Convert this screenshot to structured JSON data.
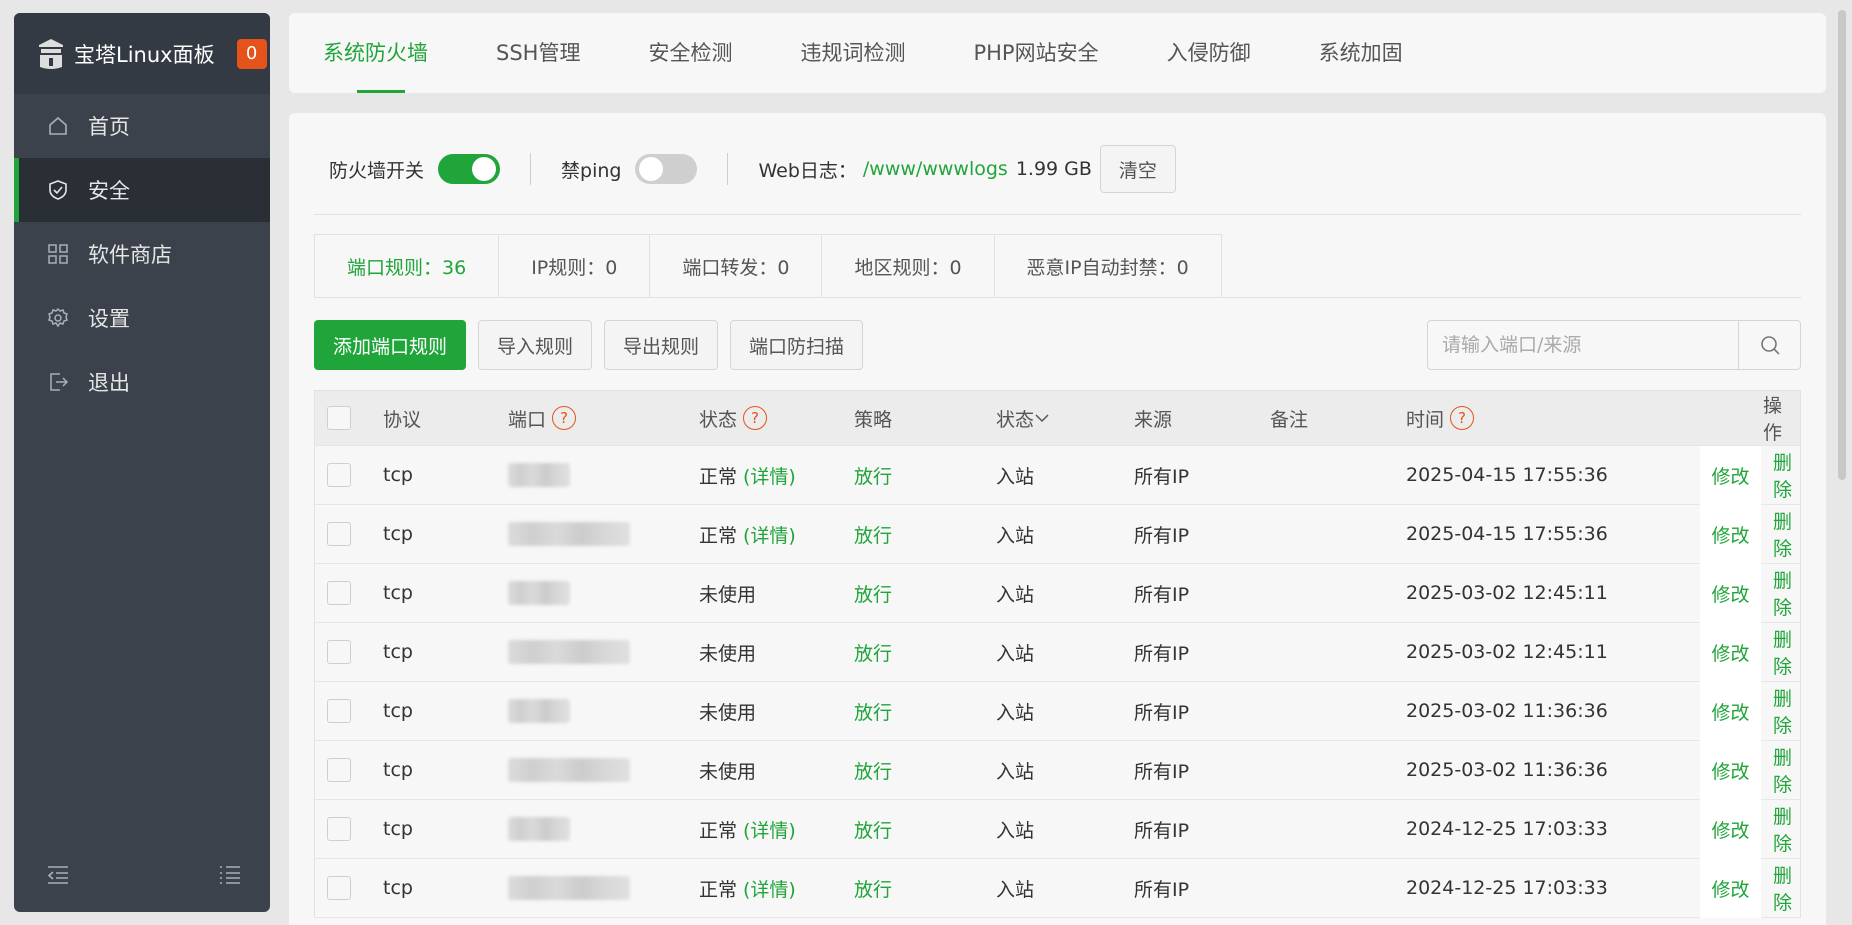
{
  "sidebar": {
    "brand": "宝塔Linux面板",
    "badge": "0",
    "items": [
      {
        "label": "首页",
        "icon": "home-icon"
      },
      {
        "label": "安全",
        "icon": "shield-icon"
      },
      {
        "label": "软件商店",
        "icon": "grid-icon"
      },
      {
        "label": "设置",
        "icon": "gear-icon"
      },
      {
        "label": "退出",
        "icon": "logout-icon"
      }
    ],
    "active_index": 1
  },
  "top_tabs": [
    "系统防火墙",
    "SSH管理",
    "安全检测",
    "违规词检测",
    "PHP网站安全",
    "入侵防御",
    "系统加固"
  ],
  "toolbar": {
    "firewall_label": "防火墙开关",
    "firewall_on": true,
    "ping_label": "禁ping",
    "ping_on": false,
    "weblog_label": "Web日志：",
    "weblog_path": "/www/wwwlogs",
    "weblog_size": "1.99 GB",
    "clear_label": "清空"
  },
  "sub_tabs": [
    "端口规则：36",
    "IP规则：0",
    "端口转发：0",
    "地区规则：0",
    "恶意IP自动封禁：0"
  ],
  "actions": {
    "add": "添加端口规则",
    "import": "导入规则",
    "export": "导出规则",
    "scan": "端口防扫描"
  },
  "search": {
    "placeholder": "请输入端口/来源"
  },
  "table": {
    "headers": {
      "protocol": "协议",
      "port": "端口",
      "status": "状态",
      "policy": "策略",
      "direction": "状态",
      "source": "来源",
      "note": "备注",
      "time": "时间",
      "ops": "操作"
    },
    "rows": [
      {
        "protocol": "tcp",
        "status": "正常",
        "detail": "(详情)",
        "policy": "放行",
        "direction": "入站",
        "source": "所有IP",
        "time": "2025-04-15 17:55:36",
        "edit": "修改",
        "delete": "删除"
      },
      {
        "protocol": "tcp",
        "status": "正常",
        "detail": "(详情)",
        "policy": "放行",
        "direction": "入站",
        "source": "所有IP",
        "time": "2025-04-15 17:55:36",
        "edit": "修改",
        "delete": "删除"
      },
      {
        "protocol": "tcp",
        "status": "未使用",
        "detail": "",
        "policy": "放行",
        "direction": "入站",
        "source": "所有IP",
        "time": "2025-03-02 12:45:11",
        "edit": "修改",
        "delete": "删除"
      },
      {
        "protocol": "tcp",
        "status": "未使用",
        "detail": "",
        "policy": "放行",
        "direction": "入站",
        "source": "所有IP",
        "time": "2025-03-02 12:45:11",
        "edit": "修改",
        "delete": "删除"
      },
      {
        "protocol": "tcp",
        "status": "未使用",
        "detail": "",
        "policy": "放行",
        "direction": "入站",
        "source": "所有IP",
        "time": "2025-03-02 11:36:36",
        "edit": "修改",
        "delete": "删除"
      },
      {
        "protocol": "tcp",
        "status": "未使用",
        "detail": "",
        "policy": "放行",
        "direction": "入站",
        "source": "所有IP",
        "time": "2025-03-02 11:36:36",
        "edit": "修改",
        "delete": "删除"
      },
      {
        "protocol": "tcp",
        "status": "正常",
        "detail": "(详情)",
        "policy": "放行",
        "direction": "入站",
        "source": "所有IP",
        "time": "2024-12-25 17:03:33",
        "edit": "修改",
        "delete": "删除"
      },
      {
        "protocol": "tcp",
        "status": "正常",
        "detail": "(详情)",
        "policy": "放行",
        "direction": "入站",
        "source": "所有IP",
        "time": "2024-12-25 17:03:33",
        "edit": "修改",
        "delete": "删除"
      }
    ]
  },
  "colors": {
    "accent": "#20a53a",
    "badge": "#e5531b",
    "sidebar": "#3b424c"
  }
}
